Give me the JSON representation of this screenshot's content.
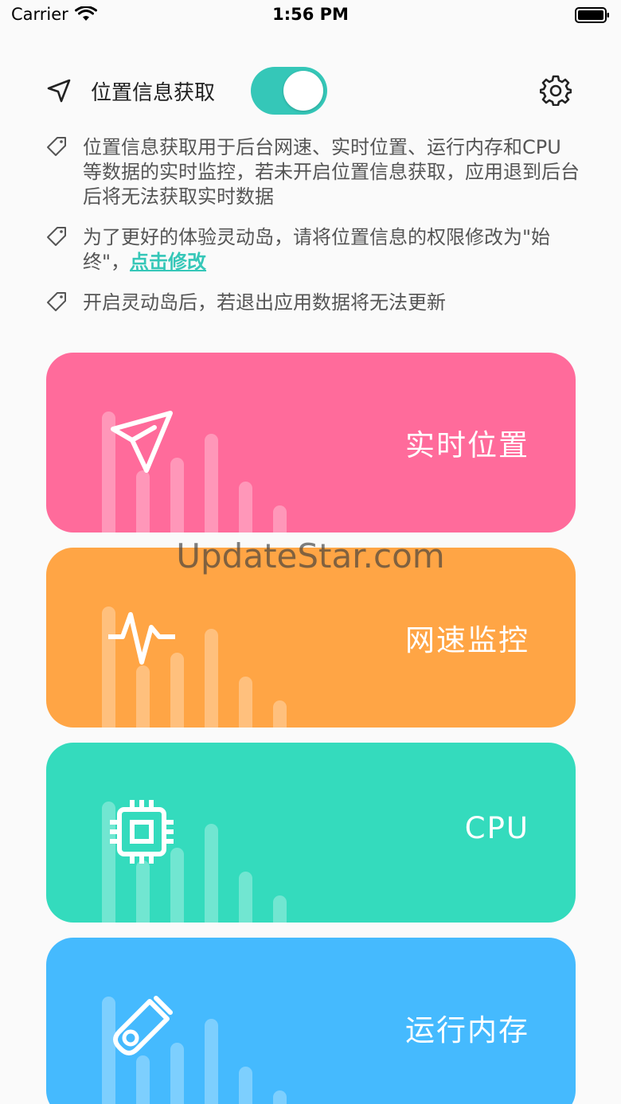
{
  "status_bar": {
    "carrier": "Carrier",
    "time": "1:56 PM"
  },
  "header": {
    "title": "位置信息获取",
    "toggle_on": true,
    "accent": "#35c7b8"
  },
  "notes": [
    {
      "text": "位置信息获取用于后台网速、实时位置、运行内存和CPU等数据的实时监控，若未开启位置信息获取，应用退到后台后将无法获取实时数据"
    },
    {
      "text": "为了更好的体验灵动岛，请将位置信息的权限修改为\"始终\"，",
      "link": "点击修改"
    },
    {
      "text": "开启灵动岛后，若退出应用数据将无法更新"
    }
  ],
  "cards": [
    {
      "label": "实时位置",
      "icon": "send-icon",
      "color": "#ff6b9b"
    },
    {
      "label": "网速监控",
      "icon": "pulse-icon",
      "color": "#ffa545"
    },
    {
      "label": "CPU",
      "icon": "chip-icon",
      "color": "#34dbbd"
    },
    {
      "label": "运行内存",
      "icon": "usb-drive-icon",
      "color": "#45bafe"
    }
  ],
  "watermark": "UpdateStar.com"
}
